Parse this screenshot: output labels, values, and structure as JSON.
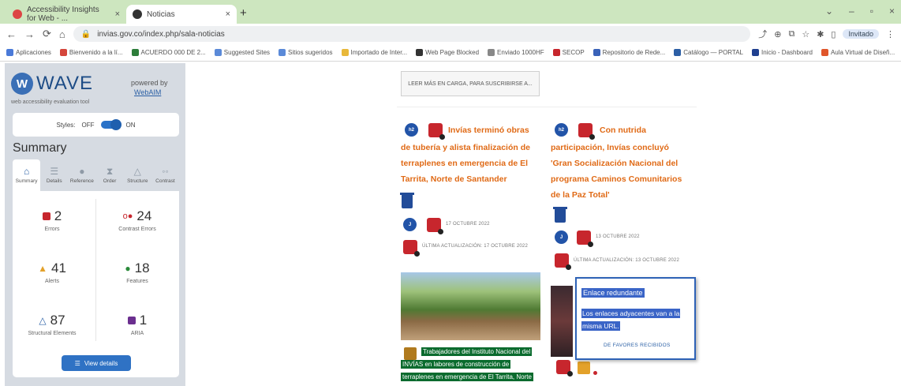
{
  "browser": {
    "tabs": [
      {
        "label": "Accessibility Insights for Web - ...",
        "close": "×"
      },
      {
        "label": "Noticias",
        "close": "×"
      }
    ],
    "new_tab": "+",
    "window_controls": [
      "⌄",
      "–",
      "▫",
      "×"
    ],
    "url": "invias.gov.co/index.php/sala-noticias",
    "profile": "Invitado",
    "bookmarks": [
      "Aplicaciones",
      "Bienvenido a la lí...",
      "ACUERDO 000 DE 2...",
      "Suggested Sites",
      "Sitios sugeridos",
      "Importado de Inter...",
      "Web Page Blocked",
      "Enviado 1000HF",
      "SECOP",
      "Repositorio de Rede...",
      "Catálogo — PORTAL",
      "Inicio - Dashboard",
      "Aula Virtual de Diseñ..."
    ]
  },
  "wave": {
    "title": "WAVE",
    "subtitle": "web accessibility evaluation tool",
    "powered_by": "powered by",
    "powered_link": "WebAIM",
    "styles_label": "Styles:",
    "off": "OFF",
    "on": "ON",
    "summary_heading": "Summary",
    "tabs": [
      {
        "label": "Summary",
        "icon": "home-icon"
      },
      {
        "label": "Details",
        "icon": "list-icon"
      },
      {
        "label": "Reference",
        "icon": "info-icon"
      },
      {
        "label": "Order",
        "icon": "order-icon"
      },
      {
        "label": "Structure",
        "icon": "structure-icon"
      },
      {
        "label": "Contrast",
        "icon": "contrast-icon"
      }
    ],
    "stats": [
      {
        "count": "2",
        "label": "Errors",
        "color": "#c7262d"
      },
      {
        "count": "24",
        "label": "Contrast Errors",
        "color": "#c7262d"
      },
      {
        "count": "41",
        "label": "Alerts",
        "color": "#e3a12a"
      },
      {
        "count": "18",
        "label": "Features",
        "color": "#2a8a3a"
      },
      {
        "count": "87",
        "label": "Structural Elements",
        "color": "#2a5fa5"
      },
      {
        "count": "1",
        "label": "ARIA",
        "color": "#6b2f8f"
      }
    ],
    "view_details": "View details"
  },
  "page": {
    "read_more": "LEER MÁS EN CARGA, PARA SUSCRIBIRSE A...",
    "article1": {
      "badge": "h2",
      "title_lines": [
        "Invías terminó obras",
        "de tubería y alista finalización de",
        "terraplenes en emergencia de El",
        "Tarrita, Norte de Santander"
      ],
      "author_badge": "J",
      "date": "17 OCTUBRE 2022",
      "updated": "ÚLTIMA ACTUALIZACIÓN: 17 OCTUBRE 2022",
      "caption": [
        "Trabajadores del Instituto Nacional del",
        "INVÍAS en labores de construcción de",
        "terraplenes en emergencia de El Tarrita, Norte"
      ]
    },
    "article2": {
      "badge": "h2",
      "title_lines": [
        "Con nutrida",
        "participación, Invías concluyó",
        "'Gran Socialización Nacional del",
        "programa Caminos Comunitarios",
        "de la Paz Total'"
      ],
      "author_badge": "J",
      "date": "13 OCTUBRE 2022",
      "updated": "ÚLTIMA ACTUALIZACIÓN: 13 OCTUBRE 2022"
    },
    "tooltip": {
      "title": "Enlace redundante",
      "body_lines": [
        "Los enlaces adyacentes van a la",
        "misma URL."
      ],
      "link": "DE FAVORES RECIBIDOS"
    }
  }
}
